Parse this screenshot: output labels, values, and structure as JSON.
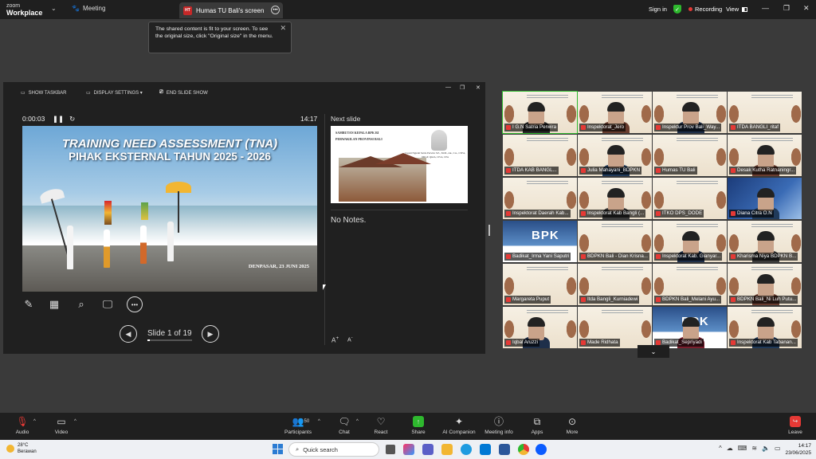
{
  "topbar": {
    "app_line1": "zoom",
    "app_line2": "Workplace",
    "meeting_label": "Meeting",
    "share_tab_badge": "HT",
    "share_tab_label": "Humas TU Bali's screen",
    "sign_in": "Sign in",
    "recording": "Recording",
    "view": "View"
  },
  "tooltip": {
    "text": "The shared content is fit to your screen. To see the original size, click \"Original size\" in the menu."
  },
  "presenter": {
    "toolbar": {
      "show_taskbar": "SHOW TASKBAR",
      "display_settings": "DISPLAY SETTINGS ▾",
      "end_show": "END SLIDE SHOW"
    },
    "timer": "0:00:03",
    "clock": "14:17",
    "slide": {
      "title1": "TRAINING NEED ASSESSMENT (TNA)",
      "title2": "PIHAK EKSTERNAL TAHUN 2025 - 2026",
      "place_date": "DENPASAR, 23 JUNI 2025"
    },
    "next_slide_header": "Next slide",
    "next_slide": {
      "title1": "SAMBUTAN KEPALA BPK RI",
      "title2": "PERWAKILAN PROVINSI BALI",
      "name": "I Gusti Ngurah Satria Perwira S.E., M.M., Ak., CA., CSFA, QRGP, QGIA, CFrA, CPA"
    },
    "notes": "No Notes.",
    "slide_count": "Slide 1 of 19",
    "progress": 0.05
  },
  "gallery": [
    {
      "name": "I G.N Satria Perwira",
      "selected": true
    },
    {
      "name": "Inspektorat_Jero"
    },
    {
      "name": "Inspektur Prov Bali_Way..."
    },
    {
      "name": "ITDA BANGLI_ritaf"
    },
    {
      "name": "ITDA KAB BANGL..."
    },
    {
      "name": "Julia Mahayani_BDPKN"
    },
    {
      "name": "Humas TU Bali"
    },
    {
      "name": "Desak Kutha Ratnaningr..."
    },
    {
      "name": "Inspektorat Daerah Kab..."
    },
    {
      "name": "Inspektorat Kab Bangli (..."
    },
    {
      "name": "ITKO DPS_DODE"
    },
    {
      "name": "Diana Citra O.N"
    },
    {
      "name": "Badikat_Irma Yani Saputri"
    },
    {
      "name": "BDPKN Bali - Dian Krisna..."
    },
    {
      "name": "Inspektorat Kab. Gianyar..."
    },
    {
      "name": "Kharisma Niya BDPKN B..."
    },
    {
      "name": "Margareta Puput"
    },
    {
      "name": "Itda Bangli_Kurniadewi"
    },
    {
      "name": "BDPKN Bali_Melani Ayu..."
    },
    {
      "name": "BDPKN Bali_Ni Luh Putu..."
    },
    {
      "name": "Iqbal Aruzzi"
    },
    {
      "name": "Made Ridhata"
    },
    {
      "name": "Badikat_Sepriyadi"
    },
    {
      "name": "Inspektorat Kab Tabanan..."
    }
  ],
  "gallery_bpk_text": "BPK",
  "bottom": {
    "audio": "Audio",
    "video": "Video",
    "participants": "Participants",
    "participants_count": "50",
    "chat": "Chat",
    "react": "React",
    "share": "Share",
    "ai": "AI Companion",
    "info": "Meeting info",
    "apps": "Apps",
    "more": "More",
    "leave": "Leave"
  },
  "taskbar": {
    "temp": "28°C",
    "weather": "Berawan",
    "search_placeholder": "Quick search",
    "time": "14:17",
    "date": "23/06/2025"
  },
  "colors": {
    "zoom_green": "#2eb82e",
    "record_red": "#e53935",
    "dark_bg": "#1f1f1f"
  }
}
